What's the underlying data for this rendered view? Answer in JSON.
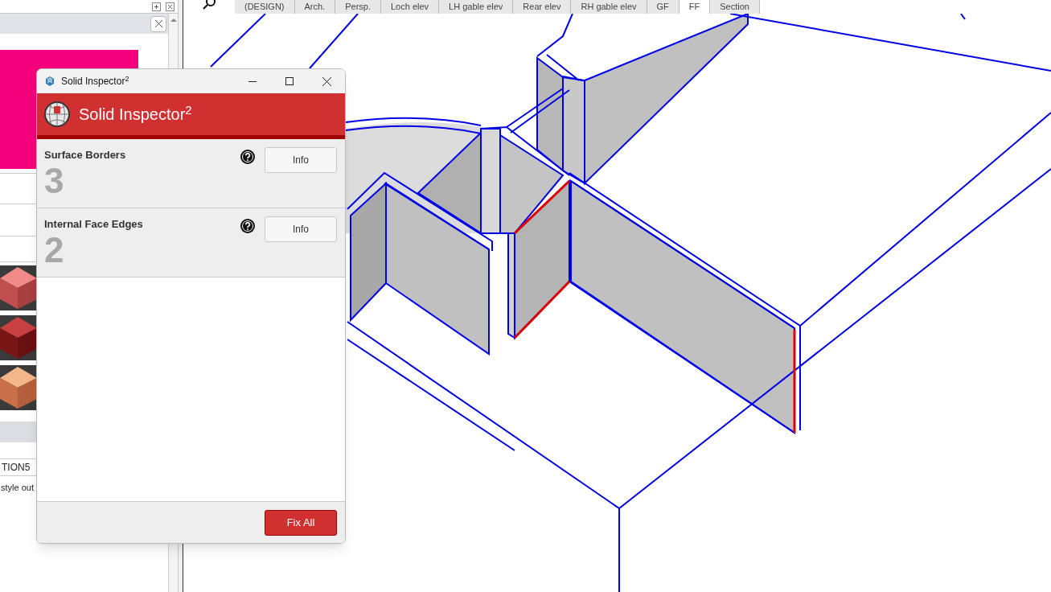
{
  "viewport_tabs": [
    {
      "label": "(DESIGN)",
      "selected": false
    },
    {
      "label": "Arch.",
      "selected": false
    },
    {
      "label": "Persp.",
      "selected": false
    },
    {
      "label": "Loch elev",
      "selected": false
    },
    {
      "label": "LH gable elev",
      "selected": false
    },
    {
      "label": "Rear elev",
      "selected": false
    },
    {
      "label": "RH gable elev",
      "selected": false
    },
    {
      "label": "GF",
      "selected": false
    },
    {
      "label": "FF",
      "selected": true
    },
    {
      "label": "Section",
      "selected": false
    }
  ],
  "side_panel": {
    "field_text": "TION5",
    "description": "style out"
  },
  "dialog": {
    "title": "Solid Inspector$^{2}$",
    "header": "Solid Inspector$^{2}$",
    "issues": [
      {
        "name": "Surface Borders",
        "count": "3",
        "button": "Info"
      },
      {
        "name": "Internal Face Edges",
        "count": "2",
        "button": "Info"
      }
    ],
    "footer_button": "Fix All"
  }
}
